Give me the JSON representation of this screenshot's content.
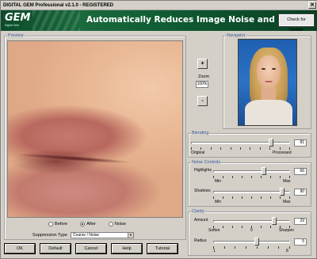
{
  "window": {
    "title": "DIGITAL GEM Professional  v2.1.0 - REGISTERED",
    "close": "✕"
  },
  "banner": {
    "logo_text": "GEM",
    "logo_subtext": "Digital Gem",
    "headline": "Automatically Reduces Image Noise and Grain",
    "update_button": "Check for Update"
  },
  "preview": {
    "legend": "Preview",
    "view_options": [
      {
        "label": "Before",
        "selected": false
      },
      {
        "label": "After",
        "selected": true
      },
      {
        "label": "Noise",
        "selected": false
      }
    ],
    "suppression_label": "Suppression Type",
    "suppression_value": "Coarse / Noise"
  },
  "zoom": {
    "plus": "+",
    "minus": "-",
    "label": "Zoom",
    "value": "100%"
  },
  "navigator": {
    "legend": "Navigator"
  },
  "blending": {
    "legend": "Blending",
    "value": "81",
    "min_label": "Original",
    "max_label": "Processed",
    "level_percent": 81
  },
  "noise_controls": {
    "legend": "Noise Controls",
    "highlights": {
      "label": "Highlights",
      "value": "66",
      "min_label": "Min",
      "max_label": "Max",
      "level_percent": 66
    },
    "shadows": {
      "label": "Shadows",
      "value": "90",
      "min_label": "Min",
      "max_label": "Max",
      "level_percent": 90
    }
  },
  "clarity": {
    "legend": "Clarity",
    "amount": {
      "label": "Amount",
      "value": "29",
      "soften_label": "Soften",
      "zero_label": "0",
      "sharpen_label": "Sharpen",
      "level_percent": 79
    },
    "radius": {
      "label": "Radius",
      "value": "5",
      "min_label": "1",
      "max_label": "8",
      "level_percent": 57
    }
  },
  "buttons": {
    "ok": "OK",
    "default": "Default",
    "cancel": "Cancel",
    "help": "Help",
    "tutorial": "Tutorial"
  },
  "colors": {
    "banner": "#0f5a32",
    "legend_text": "#3a5aa0",
    "face": "#d4d0c8"
  }
}
